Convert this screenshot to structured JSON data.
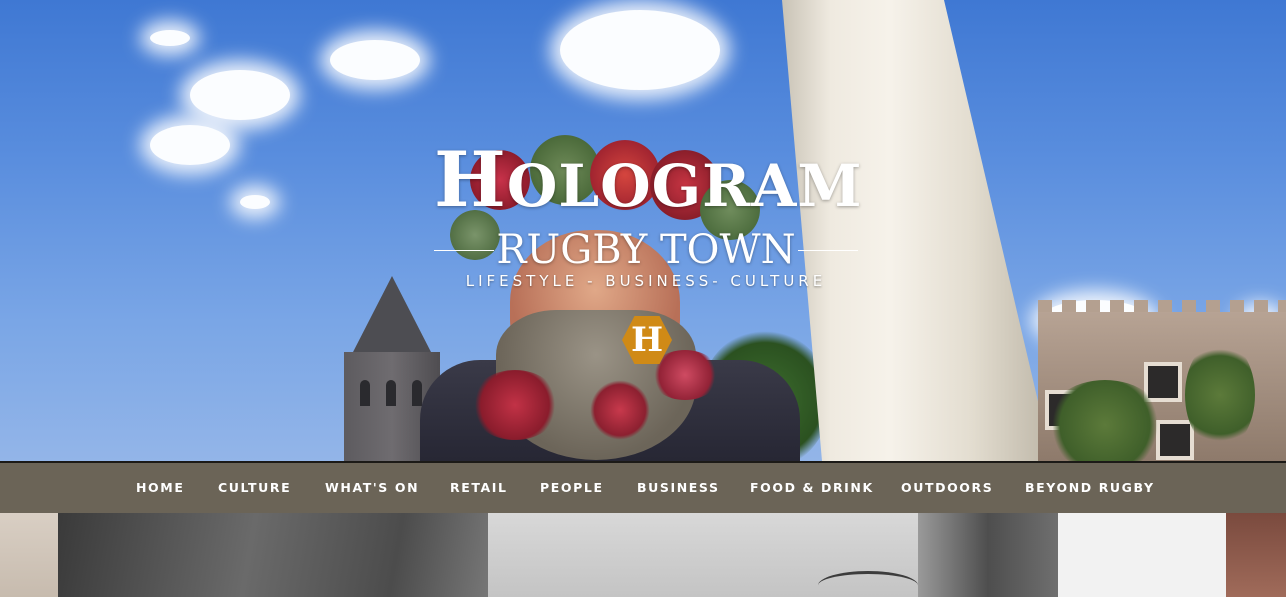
{
  "site": {
    "title_initial": "H",
    "title_rest": "OLOGRAM",
    "subtitle": "RUGBY TOWN",
    "tagline": "LIFESTYLE - BUSINESS- CULTURE",
    "badge_letter": "H",
    "badge_color": "#d08a16"
  },
  "nav": {
    "background": "#6b6457",
    "items": [
      {
        "label": "HOME"
      },
      {
        "label": "CULTURE"
      },
      {
        "label": "WHAT'S ON"
      },
      {
        "label": "RETAIL"
      },
      {
        "label": "PEOPLE"
      },
      {
        "label": "BUSINESS"
      },
      {
        "label": "FOOD & DRINK"
      },
      {
        "label": "OUTDOORS"
      },
      {
        "label": "BEYOND RUGBY"
      }
    ]
  }
}
